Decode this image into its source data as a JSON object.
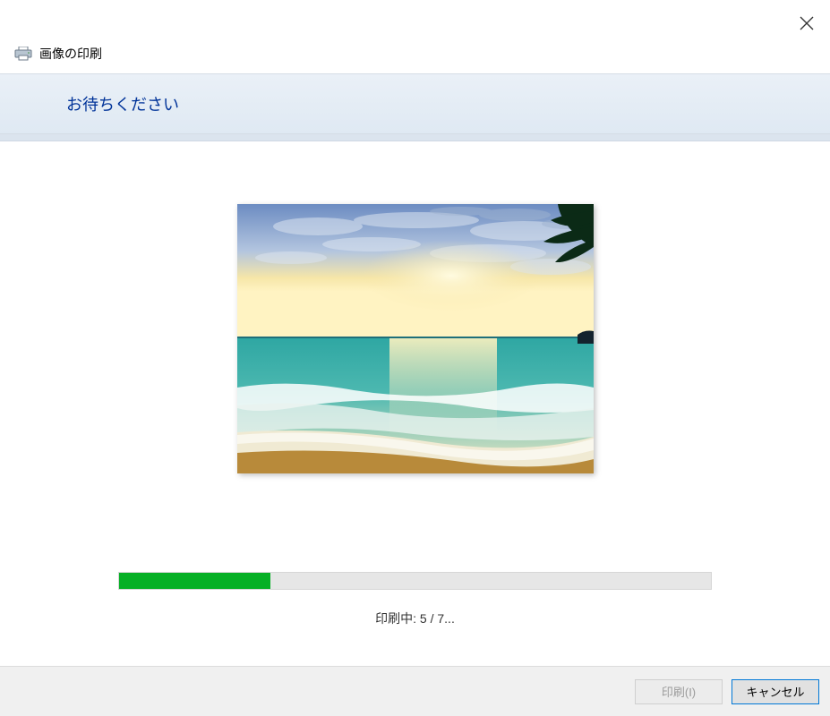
{
  "window": {
    "title": "画像の印刷",
    "close_icon": "close"
  },
  "header": {
    "title": "お待ちください"
  },
  "preview": {
    "image_description": "beach-sunset-photo"
  },
  "progress": {
    "current": 5,
    "total": 7,
    "percent": 25.5,
    "text": "印刷中: 5 / 7...",
    "fill_color": "#06b025"
  },
  "footer": {
    "print_label": "印刷(I)",
    "cancel_label": "キャンセル"
  }
}
